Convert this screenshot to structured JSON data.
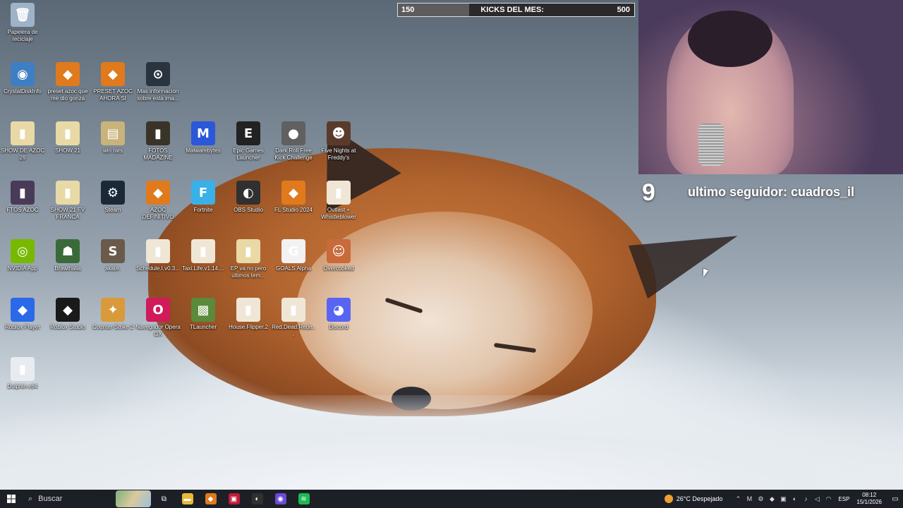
{
  "desktop": {
    "icons": [
      {
        "id": "recycle",
        "label": "Papelera de reciclaje",
        "glyph": "🗑",
        "color": "#9fb3c8",
        "icon": "recycle-bin-icon"
      },
      {
        "id": "crystal",
        "label": "CrystalDiskInfo",
        "glyph": "◉",
        "color": "#3e7fc4",
        "icon": "crystaldiskinfo-icon"
      },
      {
        "id": "preset1",
        "label": "preset azoc que me dio gonza",
        "glyph": "◆",
        "color": "#e07a1c",
        "icon": "fl-studio-icon"
      },
      {
        "id": "preset2",
        "label": "PRESET AZOC AHORA SI",
        "glyph": "◆",
        "color": "#e07a1c",
        "icon": "fl-studio-icon"
      },
      {
        "id": "info",
        "label": "Mas información sobre esta ima...",
        "glyph": "⊙",
        "color": "#2a3340",
        "icon": "info-camera-icon"
      },
      {
        "id": "show26",
        "label": "SHOW DE AZOC 26",
        "glyph": "▮",
        "color": "#e8d9a6",
        "icon": "folder-icon"
      },
      {
        "id": "show21",
        "label": "SHOW 21",
        "glyph": "▮",
        "color": "#e8d9a6",
        "icon": "folder-icon"
      },
      {
        "id": "winrars",
        "label": "win rars",
        "glyph": "▤",
        "color": "#c8b37a",
        "icon": "winrar-icon"
      },
      {
        "id": "fotos",
        "label": "FOTOS MADAZINE",
        "glyph": "▮",
        "color": "#3a3428",
        "icon": "folder-icon"
      },
      {
        "id": "malware",
        "label": "Malwarebytes",
        "glyph": "M",
        "color": "#2a58d8",
        "icon": "malwarebytes-icon"
      },
      {
        "id": "epic",
        "label": "Epic Games Launcher",
        "glyph": "E",
        "color": "#222222",
        "icon": "epic-games-icon"
      },
      {
        "id": "darkroll",
        "label": "Dark Roll Free Kick Challenge",
        "glyph": "●",
        "color": "#606060",
        "icon": "soccer-ball-icon"
      },
      {
        "id": "fnaf",
        "label": "Five Nights at Freddy's",
        "glyph": "☻",
        "color": "#5a3a2a",
        "icon": "fnaf-icon"
      },
      {
        "id": "ftos",
        "label": "FTOS AZOC",
        "glyph": "▮",
        "color": "#4a3a5a",
        "icon": "folder-icon"
      },
      {
        "id": "show21fv",
        "label": "SHOW 21 FV FRANCA",
        "glyph": "▮",
        "color": "#e8d9a6",
        "icon": "folder-icon"
      },
      {
        "id": "steam",
        "label": "Steam",
        "glyph": "⚙",
        "color": "#1b2838",
        "icon": "steam-icon"
      },
      {
        "id": "azocdef",
        "label": "AZOC DEFINITIVO",
        "glyph": "◆",
        "color": "#e07a1c",
        "icon": "fl-studio-icon"
      },
      {
        "id": "fortnite",
        "label": "Fortnite",
        "glyph": "F",
        "color": "#3ab0e8",
        "icon": "fortnite-icon"
      },
      {
        "id": "obs",
        "label": "OBS Studio",
        "glyph": "◐",
        "color": "#303030",
        "icon": "obs-icon"
      },
      {
        "id": "fl2024",
        "label": "FL Studio 2024",
        "glyph": "◆",
        "color": "#e07a1c",
        "icon": "fl-studio-icon"
      },
      {
        "id": "outlast",
        "label": "Outlast + Whistleblower",
        "glyph": "▮",
        "color": "#f0e6d6",
        "icon": "game-file-icon"
      },
      {
        "id": "nvidia",
        "label": "NVIDIA App",
        "glyph": "◎",
        "color": "#76b900",
        "icon": "nvidia-icon"
      },
      {
        "id": "brawl",
        "label": "Brawlhalla",
        "glyph": "☗",
        "color": "#3a6a3a",
        "icon": "brawlhalla-icon"
      },
      {
        "id": "skate",
        "label": "skate.",
        "glyph": "S",
        "color": "#6a5a4a",
        "icon": "skate-icon"
      },
      {
        "id": "schedule",
        "label": "Schedule.I.v0.3....",
        "glyph": "▮",
        "color": "#f0e6d6",
        "icon": "game-file-icon"
      },
      {
        "id": "taxi",
        "label": "Taxi.Life.v1.14....",
        "glyph": "▮",
        "color": "#f0e6d6",
        "icon": "game-file-icon"
      },
      {
        "id": "ep",
        "label": "EP va no pero ultimos tem...",
        "glyph": "▮",
        "color": "#e8d9a6",
        "icon": "folder-icon"
      },
      {
        "id": "goals",
        "label": "GOALS Alpha",
        "glyph": "G",
        "color": "#f2f2f2",
        "icon": "goals-icon"
      },
      {
        "id": "overcooked",
        "label": "Overcooked",
        "glyph": "☺",
        "color": "#c86a3a",
        "icon": "overcooked-icon"
      },
      {
        "id": "roblox",
        "label": "Roblox Player",
        "glyph": "◆",
        "color": "#2a6ae8",
        "icon": "roblox-icon"
      },
      {
        "id": "robloxstudio",
        "label": "Roblox Studio",
        "glyph": "◆",
        "color": "#1a1a1a",
        "icon": "roblox-studio-icon"
      },
      {
        "id": "cs2",
        "label": "Counter-Strike 2",
        "glyph": "✦",
        "color": "#d89a3a",
        "icon": "counter-strike-icon"
      },
      {
        "id": "opera",
        "label": "Navegador Opera GX",
        "glyph": "O",
        "color": "#d01a5a",
        "icon": "opera-gx-icon"
      },
      {
        "id": "tlauncher",
        "label": "TLauncher",
        "glyph": "▩",
        "color": "#5a8a3a",
        "icon": "tlauncher-icon"
      },
      {
        "id": "houseflipper",
        "label": "House.Flipper.2",
        "glyph": "▮",
        "color": "#f0e6d6",
        "icon": "game-file-icon"
      },
      {
        "id": "reddead",
        "label": "Red.Dead.Rede...",
        "glyph": "▮",
        "color": "#f0e6d6",
        "icon": "game-file-icon"
      },
      {
        "id": "discord",
        "label": "Discord",
        "glyph": "◕",
        "color": "#5865f2",
        "icon": "discord-icon"
      },
      {
        "id": "dolphin",
        "label": "Dolphin-x64",
        "glyph": "▮",
        "color": "#e8ecf0",
        "icon": "folder-icon"
      }
    ]
  },
  "overlay": {
    "kicks_current": "150",
    "kicks_label": "KICKS DEL MES:",
    "kicks_goal": "500",
    "kicks_progress": 0.3,
    "follower_count": "9",
    "follower_text": "ultimo seguidor: cuadros_il"
  },
  "taskbar": {
    "search_label": "Buscar",
    "weather_text": "26°C  Despejado",
    "language": "ESP",
    "time": "08:12",
    "date": "15/1/2026",
    "apps": [
      {
        "icon": "task-view-icon",
        "color": "#1c2026",
        "glyph": "⧉"
      },
      {
        "icon": "file-explorer-icon",
        "color": "#e8b83a",
        "glyph": "▬"
      },
      {
        "icon": "fl-studio-icon",
        "color": "#e07a1c",
        "glyph": "◆"
      },
      {
        "icon": "app-red-icon",
        "color": "#c01a3a",
        "glyph": "▣"
      },
      {
        "icon": "obs-icon",
        "color": "#303030",
        "glyph": "◐"
      },
      {
        "icon": "browser-icon",
        "color": "#6a4ad8",
        "glyph": "◉"
      },
      {
        "icon": "spotify-icon",
        "color": "#1db954",
        "glyph": "≋"
      }
    ]
  }
}
